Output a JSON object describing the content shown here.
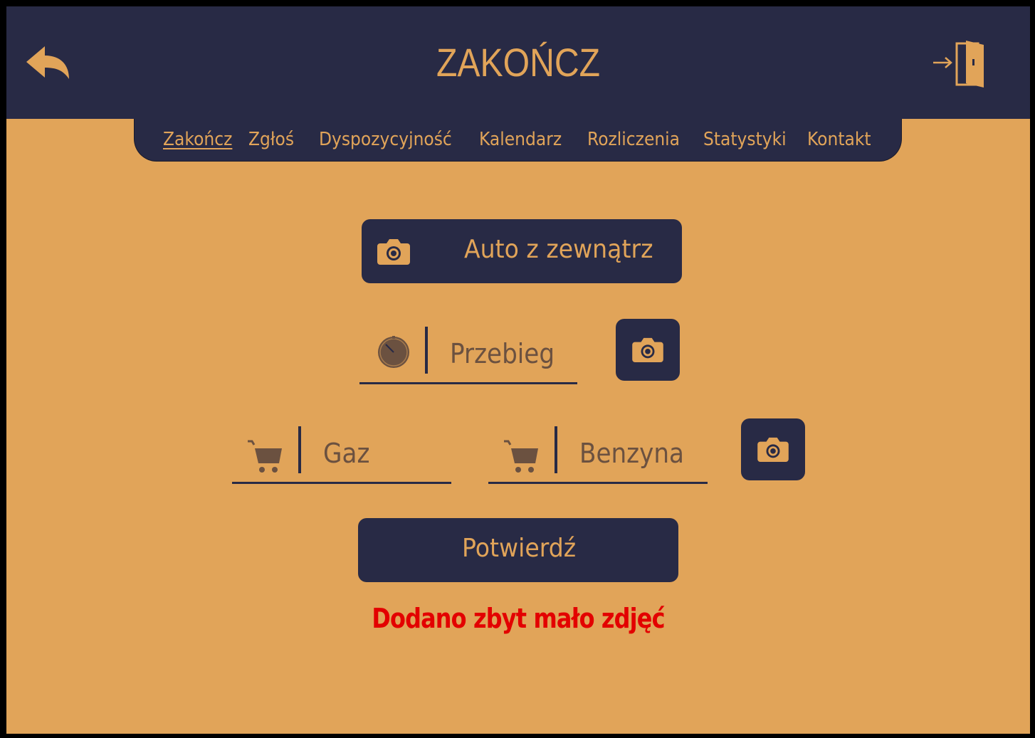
{
  "header": {
    "title": "ZAKOŃCZ",
    "back_icon": "reply-arrow-icon",
    "logout_icon": "exit-door-icon"
  },
  "nav": {
    "items": [
      {
        "label": "Zakończ",
        "active": true
      },
      {
        "label": "Zgłoś",
        "active": false
      },
      {
        "label": "Dyspozycyjność",
        "active": false
      },
      {
        "label": "Kalendarz",
        "active": false
      },
      {
        "label": "Rozliczenia",
        "active": false
      },
      {
        "label": "Statystyki",
        "active": false
      },
      {
        "label": "Kontakt",
        "active": false
      }
    ]
  },
  "form": {
    "outside_photo_label": "Auto z zewnątrz",
    "mileage_placeholder": "Przebieg",
    "gas_placeholder": "Gaz",
    "petrol_placeholder": "Benzyna",
    "confirm_label": "Potwierdź",
    "error_message": "Dodano zbyt mało zdjęć"
  },
  "colors": {
    "background": "#e1a459",
    "dark": "#282a45",
    "accent": "#e1a459",
    "muted_icon": "#6b5140",
    "error": "#e30000"
  }
}
